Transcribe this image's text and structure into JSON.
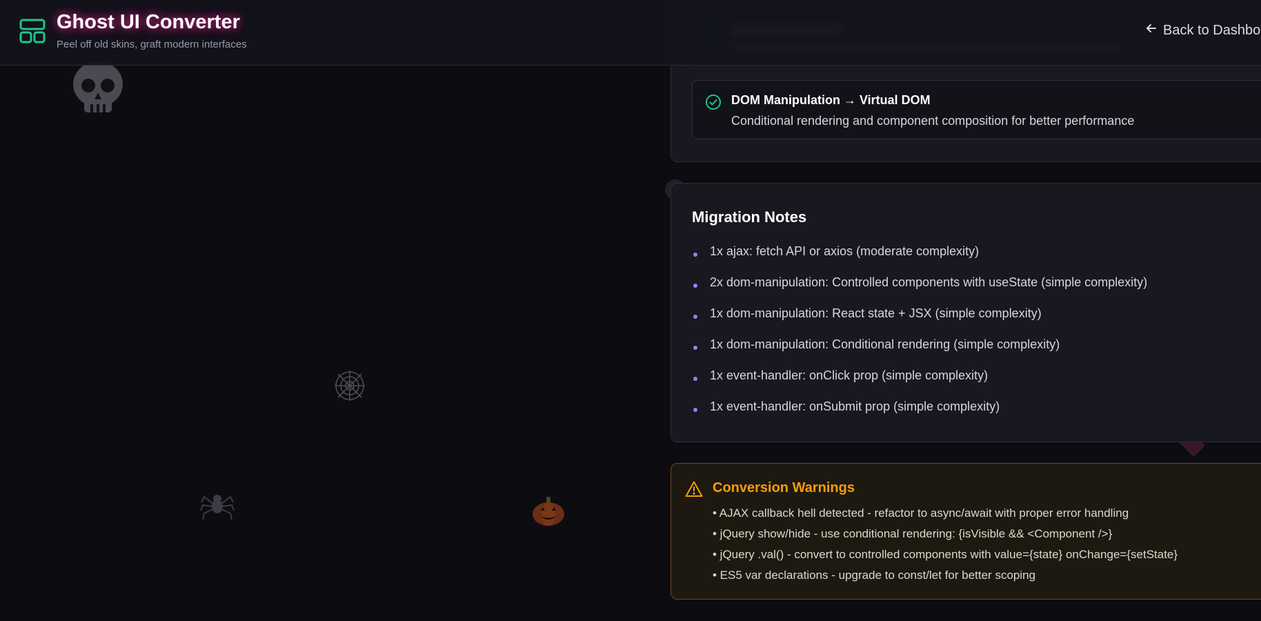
{
  "header": {
    "title": "Ghost UI Converter",
    "subtitle": "Peel off old skins, graft modern interfaces",
    "back_label": "Back to Dashboard",
    "logo_icon": "layout-dashboard-icon",
    "back_icon": "arrow-left-icon"
  },
  "conversion": {
    "item": {
      "title": "DOM Manipulation → Virtual DOM",
      "description": "Conditional rendering and component composition for better performance",
      "icon": "check-circle-icon"
    }
  },
  "notes": {
    "title": "Migration Notes",
    "items": [
      "1x ajax: fetch API or axios (moderate complexity)",
      "2x dom-manipulation: Controlled components with useState (simple complexity)",
      "1x dom-manipulation: React state + JSX (simple complexity)",
      "1x dom-manipulation: Conditional rendering (simple complexity)",
      "1x event-handler: onClick prop (simple complexity)",
      "1x event-handler: onSubmit prop (simple complexity)"
    ]
  },
  "warnings": {
    "title": "Conversion Warnings",
    "icon": "alert-triangle-icon",
    "items": [
      "• AJAX callback hell detected - refactor to async/await with proper error handling",
      "• jQuery show/hide - use conditional rendering: {isVisible && <Component />}",
      "• jQuery .val() - convert to controlled components with value={state} onChange={setState}",
      "• ES5 var declarations - upgrade to const/let for better scoping"
    ]
  },
  "decorations": [
    "skull-icon",
    "spider-web-icon",
    "spider-icon",
    "pumpkin-icon"
  ],
  "colors": {
    "accent_green": "#22c58b",
    "accent_purple": "#a37bff",
    "warning_orange": "#f59e0b",
    "title_glow": "#ff28a0",
    "background": "#0c0c11"
  }
}
